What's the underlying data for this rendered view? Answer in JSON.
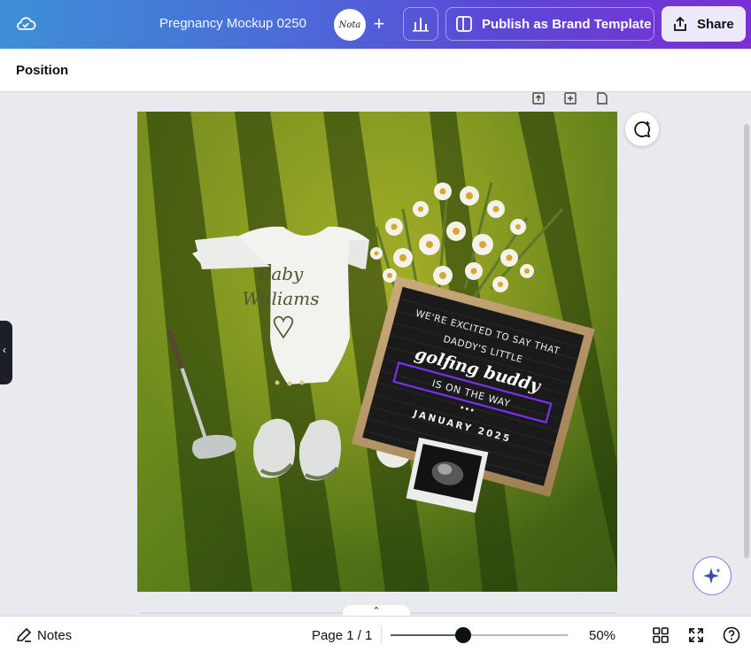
{
  "header": {
    "title": "Pregnancy Mockup 0250",
    "avatar_text": "Nota",
    "add_label": "+",
    "publish_label": "Publish as Brand Template",
    "share_label": "Share"
  },
  "toolbar": {
    "position_label": "Position"
  },
  "canvas": {
    "onesie_line1": "Baby",
    "onesie_line2": "Williams",
    "board_line1": "WE'RE EXCITED TO SAY THAT",
    "board_line2": "DADDY'S LITTLE",
    "board_line3": "golfing buddy",
    "board_line4": "IS ON THE WAY",
    "board_dots": "•••",
    "board_line5": "JANUARY 2025",
    "collapse_chevron": "‹",
    "page_tab_chevron": "⌃"
  },
  "footer": {
    "notes_label": "Notes",
    "page_info": "Page 1 / 1",
    "zoom_level": 0.41,
    "zoom_label": "50%"
  },
  "colors": {
    "accent_purple": "#7b2ff7",
    "grass": "#5c7a1c",
    "board": "#1b1a1a"
  }
}
